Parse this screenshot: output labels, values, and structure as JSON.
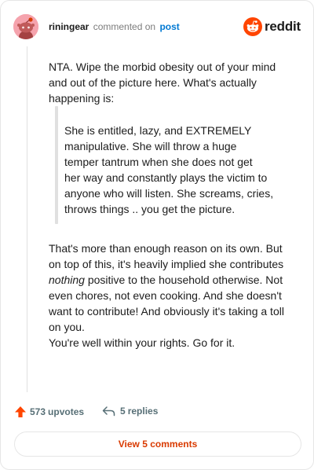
{
  "header": {
    "username": "riningear",
    "action_text": "commented on",
    "post_link": "post",
    "brand": "reddit"
  },
  "comment": {
    "intro": "NTA. Wipe the morbid obesity out of your mind and out of the picture here. What's actually happening is:",
    "quote_lines": [
      "She is entitled, lazy, and EXTREMELY",
      "manipulative. She will throw a huge",
      "temper tantrum when she does not get",
      "her way and constantly plays the victim to",
      "anyone who will listen. She screams, cries,",
      "throws things .. you get the picture."
    ],
    "para2_before": "That's more than enough reason on its own. But on top of this, it's heavily implied she contributes ",
    "para2_emphasis": "nothing",
    "para2_after": " positive to the household otherwise. Not even chores, not even cooking. And she doesn't want to contribute! And obviously it's taking a toll on you.",
    "closing": "You're well within your rights. Go for it."
  },
  "footer": {
    "upvote_count": "573",
    "upvote_unit": "upvotes",
    "reply_count": "5",
    "reply_unit": "replies",
    "view_comments_label": "View 5 comments"
  },
  "colors": {
    "accent": "#d93a00",
    "upvote": "#ff4500",
    "link": "#0079d3",
    "avatar_bg": "#f5a3ad"
  }
}
